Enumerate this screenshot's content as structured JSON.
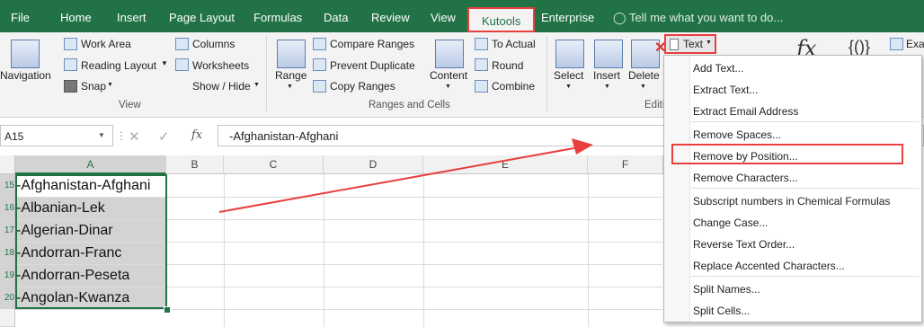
{
  "tabs": [
    "File",
    "Home",
    "Insert",
    "Page Layout",
    "Formulas",
    "Data",
    "Review",
    "View",
    "Kutools",
    "Enterprise"
  ],
  "active_tab": "Kutools",
  "tell_me": "Tell me what you want to do...",
  "ribbon": {
    "navigation": "Navigation",
    "work_area": "Work Area",
    "reading_layout": "Reading Layout",
    "snap": "Snap",
    "columns": "Columns",
    "worksheets": "Worksheets",
    "show_hide": "Show / Hide",
    "view_group": "View",
    "range": "Range",
    "compare_ranges": "Compare Ranges",
    "prevent_duplicate": "Prevent Duplicate",
    "copy_ranges": "Copy Ranges",
    "content": "Content",
    "to_actual": "To Actual",
    "round": "Round",
    "combine": "Combine",
    "ranges_cells_group": "Ranges and Cells",
    "select": "Select",
    "insert": "Insert",
    "delete": "Delete",
    "text": "Text",
    "editing_group": "Editi",
    "fx": "fx",
    "braces": "{()}",
    "exa": "Exac"
  },
  "formula_bar": {
    "name_box": "A15",
    "fx": "fx",
    "value": "-Afghanistan-Afghani"
  },
  "columns": [
    "A",
    "B",
    "C",
    "D",
    "E",
    "F"
  ],
  "rows": [
    {
      "num": "15",
      "a": "-Afghanistan-Afghani"
    },
    {
      "num": "16",
      "a": "-Albanian-Lek"
    },
    {
      "num": "17",
      "a": "-Algerian-Dinar"
    },
    {
      "num": "18",
      "a": "-Andorran-Franc"
    },
    {
      "num": "19",
      "a": "-Andorran-Peseta"
    },
    {
      "num": "20",
      "a": "-Angolan-Kwanza"
    }
  ],
  "menu": [
    "Add Text...",
    "Extract Text...",
    "Extract Email Address",
    "Remove Spaces...",
    "Remove by Position...",
    "Remove Characters...",
    "Subscript numbers in Chemical Formulas",
    "Change Case...",
    "Reverse Text Order...",
    "Replace Accented Characters...",
    "Split Names...",
    "Split Cells..."
  ],
  "colors": {
    "excel_green": "#217346",
    "highlight_red": "#e8403f",
    "selection": "#d3d3d3"
  }
}
